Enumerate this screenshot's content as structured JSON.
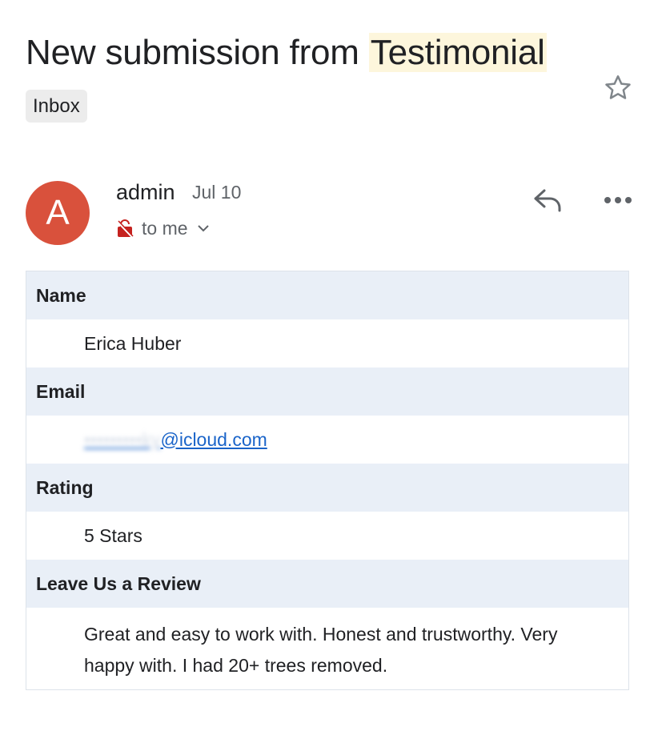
{
  "email": {
    "subject_prefix": "New submission from ",
    "subject_highlight": "Testimonial",
    "label": "Inbox",
    "sender": {
      "avatar_letter": "A",
      "name": "admin",
      "date": "Jul 10",
      "recipient": "to me"
    },
    "icons": {
      "star": "star-icon",
      "reply": "reply-icon",
      "more": "more-horizontal-icon",
      "lock": "lock-off-icon",
      "expand": "chevron-down-icon"
    },
    "colors": {
      "avatar_bg": "#d9513c",
      "label_row_bg": "#e9eff7",
      "highlight_bg": "#fdf6dc",
      "link": "#1a64c9"
    }
  },
  "form": {
    "fields": [
      {
        "label": "Name",
        "value": "Erica Huber"
      },
      {
        "label": "Email",
        "value_redacted": "•••••••••ky",
        "value_domain": "@icloud.com"
      },
      {
        "label": "Rating",
        "value": "5 Stars"
      },
      {
        "label": "Leave Us a Review",
        "value": "Great and easy to work with. Honest and trustworthy. Very happy with. I had 20+ trees removed."
      }
    ]
  }
}
